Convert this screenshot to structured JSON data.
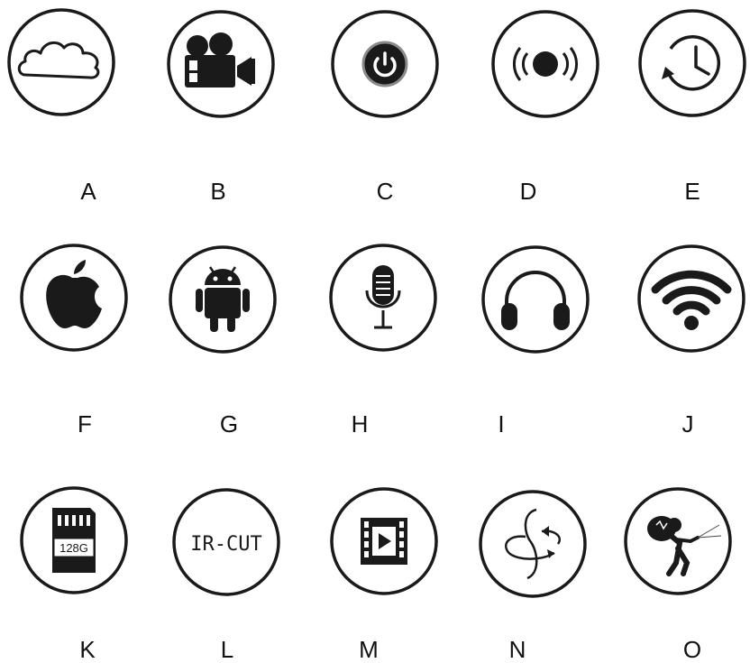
{
  "items": [
    {
      "letter": "A",
      "icon": "cloud-icon"
    },
    {
      "letter": "B",
      "icon": "movie-camera-icon"
    },
    {
      "letter": "C",
      "icon": "power-icon"
    },
    {
      "letter": "D",
      "icon": "alarm-sound-icon"
    },
    {
      "letter": "E",
      "icon": "history-icon"
    },
    {
      "letter": "F",
      "icon": "apple-icon"
    },
    {
      "letter": "G",
      "icon": "android-icon"
    },
    {
      "letter": "H",
      "icon": "microphone-icon"
    },
    {
      "letter": "I",
      "icon": "headphones-icon"
    },
    {
      "letter": "J",
      "icon": "wifi-icon"
    },
    {
      "letter": "K",
      "icon": "sd-card-icon",
      "text": "128G"
    },
    {
      "letter": "L",
      "icon": "ir-cut-icon",
      "text": "IR-CUT"
    },
    {
      "letter": "M",
      "icon": "video-icon"
    },
    {
      "letter": "N",
      "icon": "rotate-icon"
    },
    {
      "letter": "O",
      "icon": "burglar-alarm-icon"
    }
  ],
  "colors": {
    "ink": "#111111",
    "ring": "#1a1a1a",
    "background": "#ffffff"
  }
}
